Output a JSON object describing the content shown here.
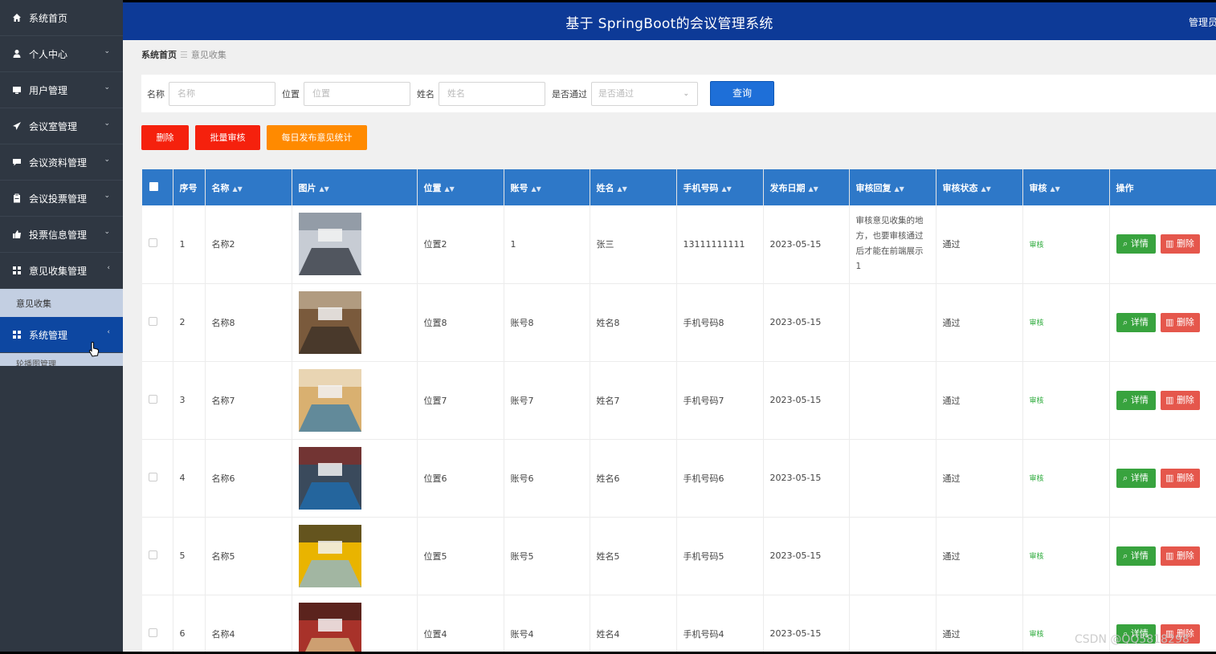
{
  "header": {
    "title": "基于 SpringBoot的会议管理系统",
    "user": "管理员"
  },
  "sidebar": {
    "items": [
      {
        "label": "系统首页",
        "icon": "home-icon",
        "chevron": ""
      },
      {
        "label": "个人中心",
        "icon": "user-icon",
        "chevron": "⌄"
      },
      {
        "label": "用户管理",
        "icon": "monitor-icon",
        "chevron": "⌄"
      },
      {
        "label": "会议室管理",
        "icon": "send-icon",
        "chevron": "⌄"
      },
      {
        "label": "会议资料管理",
        "icon": "comment-icon",
        "chevron": "⌄"
      },
      {
        "label": "会议投票管理",
        "icon": "clipboard-icon",
        "chevron": "⌄"
      },
      {
        "label": "投票信息管理",
        "icon": "thumbs-up-icon",
        "chevron": "⌄"
      },
      {
        "label": "意见收集管理",
        "icon": "grid-icon",
        "chevron": "‹"
      }
    ],
    "sub_item": "意见收集",
    "system": {
      "label": "系统管理",
      "icon": "grid-icon",
      "chevron": "‹"
    },
    "peek": "轮播图管理"
  },
  "breadcrumb": {
    "home": "系统首页",
    "sep": "☰",
    "current": "意见收集"
  },
  "search": {
    "name_label": "名称",
    "name_placeholder": "名称",
    "location_label": "位置",
    "location_placeholder": "位置",
    "person_label": "姓名",
    "person_placeholder": "姓名",
    "pass_label": "是否通过",
    "pass_placeholder": "是否通过",
    "query_button": "查询"
  },
  "actions": {
    "delete": "删除",
    "batch_audit": "批量审核",
    "daily_stats": "每日发布意见统计"
  },
  "table": {
    "headers": [
      "序号",
      "名称",
      "图片",
      "位置",
      "账号",
      "姓名",
      "手机号码",
      "发布日期",
      "审核回复",
      "审核状态",
      "审核",
      "操作"
    ],
    "detail_label": "详情",
    "delete_label": "删除",
    "audit_label": "审核",
    "rows": [
      {
        "no": "1",
        "name": "名称2",
        "location": "位置2",
        "account": "1",
        "person": "张三",
        "phone": "13111111111",
        "date": "2023-05-15",
        "reply": "审核意见收集的地方，也要审核通过后才能在前端展示 1",
        "status": "通过"
      },
      {
        "no": "2",
        "name": "名称8",
        "location": "位置8",
        "account": "账号8",
        "person": "姓名8",
        "phone": "手机号码8",
        "date": "2023-05-15",
        "reply": "",
        "status": "通过"
      },
      {
        "no": "3",
        "name": "名称7",
        "location": "位置7",
        "account": "账号7",
        "person": "姓名7",
        "phone": "手机号码7",
        "date": "2023-05-15",
        "reply": "",
        "status": "通过"
      },
      {
        "no": "4",
        "name": "名称6",
        "location": "位置6",
        "account": "账号6",
        "person": "姓名6",
        "phone": "手机号码6",
        "date": "2023-05-15",
        "reply": "",
        "status": "通过"
      },
      {
        "no": "5",
        "name": "名称5",
        "location": "位置5",
        "account": "账号5",
        "person": "姓名5",
        "phone": "手机号码5",
        "date": "2023-05-15",
        "reply": "",
        "status": "通过"
      },
      {
        "no": "6",
        "name": "名称4",
        "location": "位置4",
        "account": "账号4",
        "person": "姓名4",
        "phone": "手机号码4",
        "date": "2023-05-15",
        "reply": "",
        "status": "通过"
      }
    ]
  },
  "watermark": "CSDN @QQ5818298"
}
